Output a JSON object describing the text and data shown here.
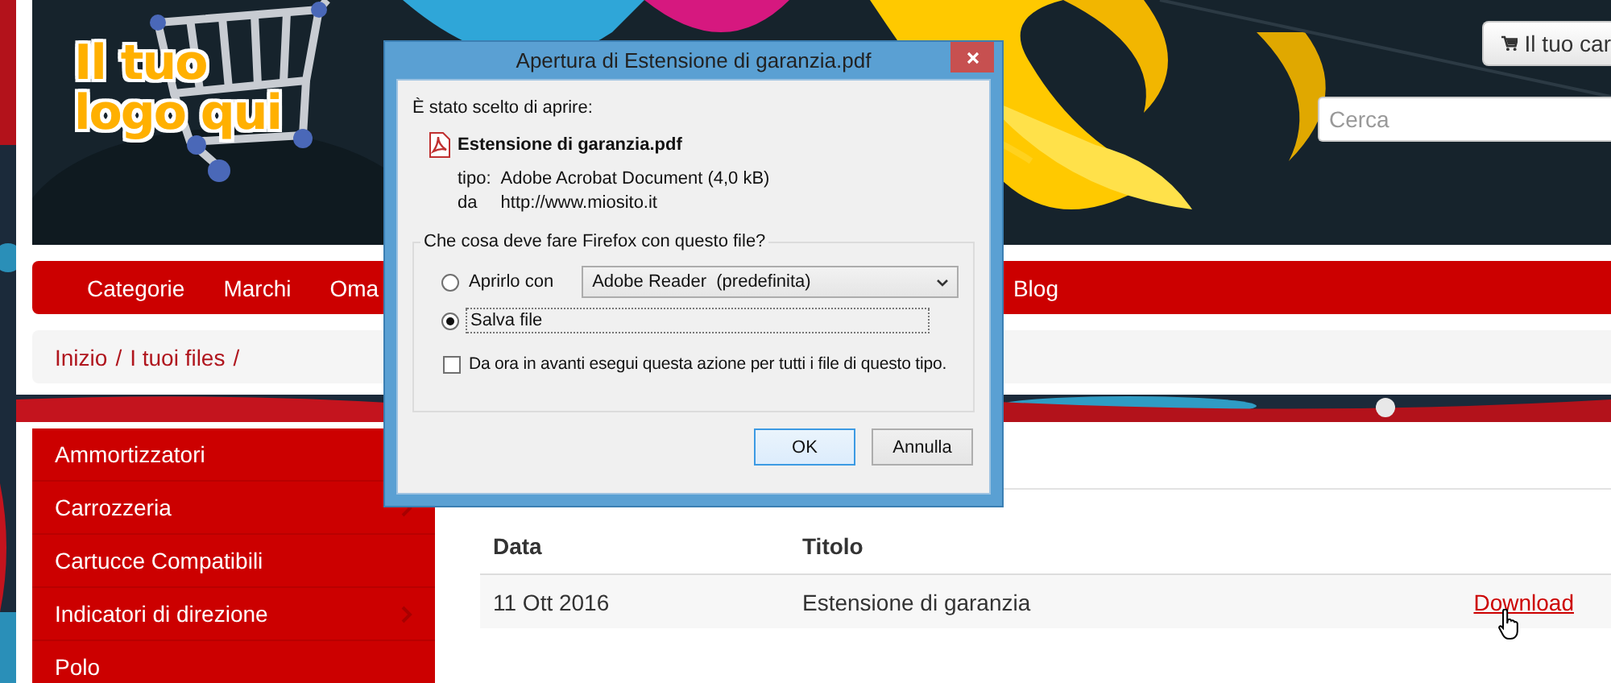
{
  "header": {
    "logo_text": "Il tuo logo qui",
    "cart_button": "Il tuo car",
    "search": {
      "placeholder": "Cerca"
    }
  },
  "nav": {
    "items": [
      "Categorie",
      "Marchi",
      "Oma",
      "Blog"
    ]
  },
  "breadcrumb": {
    "items": [
      "Inizio",
      "I tuoi files"
    ],
    "separator": "/"
  },
  "sidebar": {
    "items": [
      {
        "label": "Ammortizzatori"
      },
      {
        "label": "Carrozzeria",
        "submenu": true
      },
      {
        "label": "Cartucce Compatibili",
        "submenu": false
      },
      {
        "label": "Indicatori di direzione",
        "submenu": true
      },
      {
        "label": "Polo",
        "submenu": false
      }
    ]
  },
  "table": {
    "columns": [
      "Data",
      "Titolo"
    ],
    "rows": [
      {
        "date": "11 Ott 2016",
        "title": "Estensione di garanzia",
        "action": "Download"
      }
    ]
  },
  "dialog": {
    "title": "Apertura di Estensione di garanzia.pdf",
    "intro": "È stato scelto di aprire:",
    "file_name": "Estensione di garanzia.pdf",
    "type_label": "tipo:",
    "type_value": "Adobe Acrobat Document (4,0 kB)",
    "from_label": "da",
    "from_value": "http://www.miosito.it",
    "group_label": "Che cosa deve fare Firefox con questo file?",
    "options": [
      {
        "kind": "open",
        "label": "Aprirlo con",
        "selected": false,
        "app": "Adobe Reader  (predefinita)"
      },
      {
        "kind": "save",
        "label": "Salva file",
        "selected": true
      }
    ],
    "remember": {
      "label": "Da ora in avanti esegui questa azione per tutti i file di questo tipo.",
      "checked": false
    },
    "buttons": [
      {
        "label": "OK",
        "default": true
      },
      {
        "label": "Annulla",
        "default": false
      }
    ]
  }
}
